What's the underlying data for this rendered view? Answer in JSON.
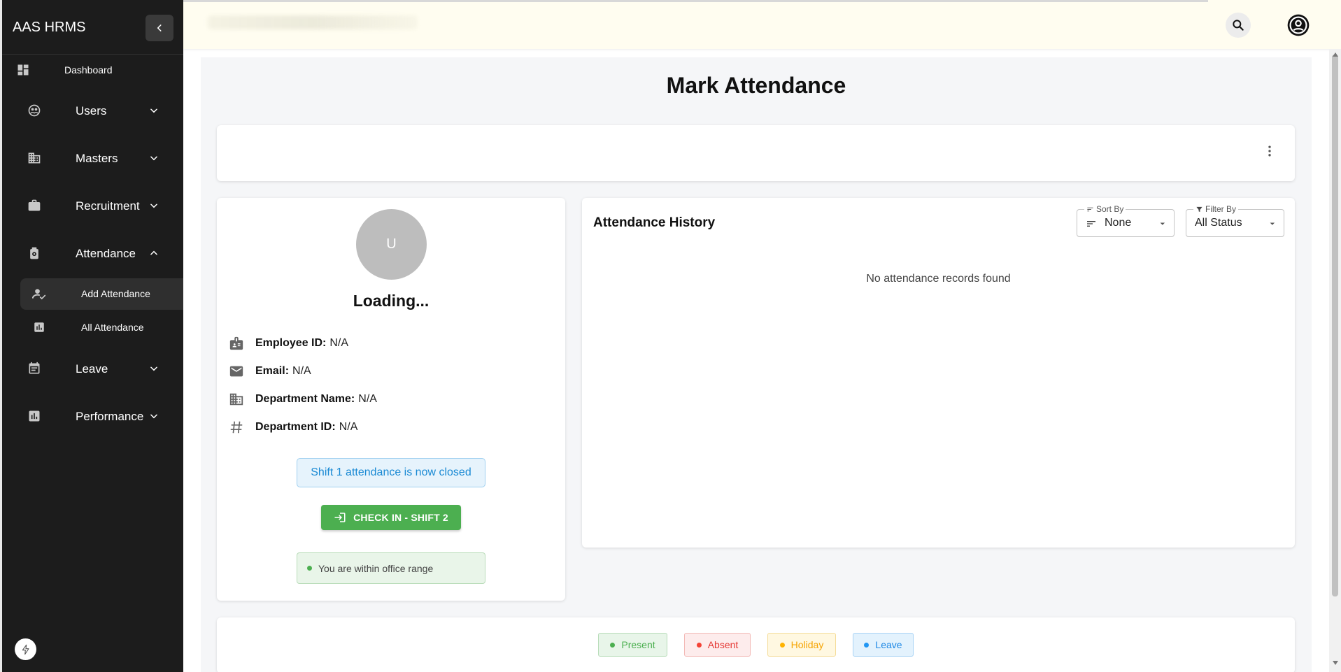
{
  "app": {
    "brand": "AAS HRMS"
  },
  "sidebar": {
    "items": [
      {
        "label": "Dashboard",
        "icon": "dashboard-icon"
      },
      {
        "label": "Users",
        "icon": "users-icon"
      },
      {
        "label": "Masters",
        "icon": "building-icon"
      },
      {
        "label": "Recruitment",
        "icon": "briefcase-icon"
      },
      {
        "label": "Attendance",
        "icon": "attendance-icon"
      },
      {
        "label": "Leave",
        "icon": "calendar-icon"
      },
      {
        "label": "Performance",
        "icon": "chart-icon"
      }
    ],
    "attendance_sub": [
      {
        "label": "Add Attendance",
        "icon": "person-check-icon",
        "active": true
      },
      {
        "label": "All Attendance",
        "icon": "bar-chart-icon",
        "active": false
      }
    ]
  },
  "page": {
    "title": "Mark Attendance"
  },
  "profile": {
    "avatar_letter": "U",
    "name": "Loading...",
    "fields": [
      {
        "key": "Employee ID:",
        "value": "N/A",
        "icon": "badge-icon"
      },
      {
        "key": "Email:",
        "value": "N/A",
        "icon": "mail-icon"
      },
      {
        "key": "Department Name:",
        "value": "N/A",
        "icon": "building-icon"
      },
      {
        "key": "Department ID:",
        "value": "N/A",
        "icon": "hash-icon"
      }
    ],
    "shift_alert": "Shift 1 attendance is now closed",
    "checkin_label": "CHECK IN - SHIFT 2",
    "range_status": "You are within office range"
  },
  "history": {
    "title": "Attendance History",
    "sort": {
      "label": "Sort By",
      "value": "None"
    },
    "filter": {
      "label": "Filter By",
      "value": "All Status"
    },
    "empty": "No attendance records found"
  },
  "legend": [
    {
      "label": "Present",
      "color": "#4caf50",
      "bg": "#e8f5e9",
      "border": "#b7dcb8",
      "text": "#4caf50"
    },
    {
      "label": "Absent",
      "color": "#f44336",
      "bg": "#fdecec",
      "border": "#f3b9b6",
      "text": "#e53935"
    },
    {
      "label": "Holiday",
      "color": "#ffb300",
      "bg": "#fff8e1",
      "border": "#f5dd9a",
      "text": "#f5a300"
    },
    {
      "label": "Leave",
      "color": "#2196f3",
      "bg": "#e3f2fd",
      "border": "#a9d3f5",
      "text": "#1e88e5"
    }
  ]
}
